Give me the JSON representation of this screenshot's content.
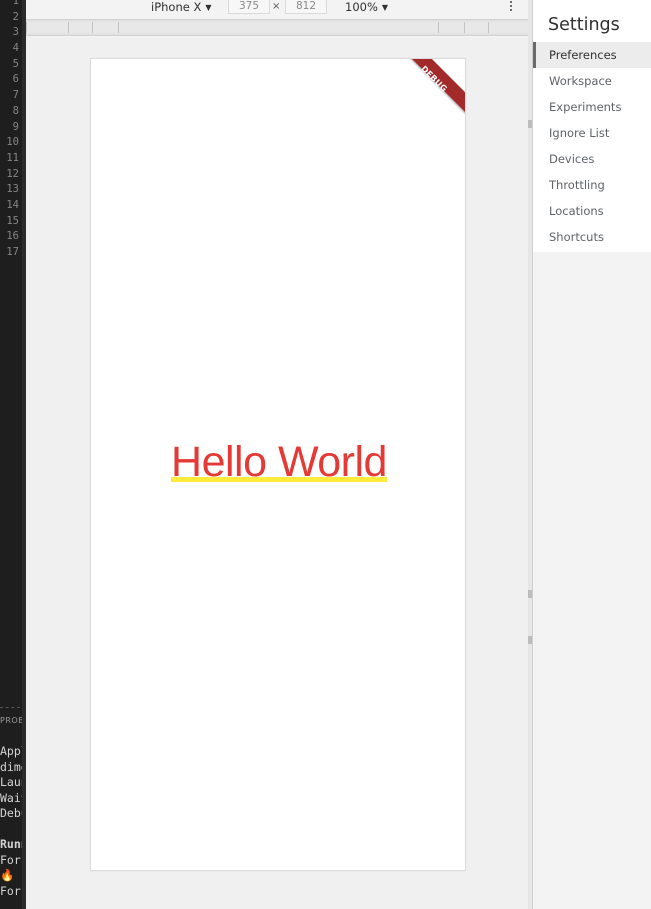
{
  "editor": {
    "line_numbers": [
      "1",
      "2",
      "3",
      "4",
      "5",
      "6",
      "7",
      "8",
      "9",
      "10",
      "11",
      "12",
      "13",
      "14",
      "15",
      "16",
      "17"
    ],
    "panel_tab": "PROB",
    "terminal_lines": [
      "Appl",
      "dime",
      "Laun",
      "Wait",
      "Debu",
      "",
      "Runn",
      "For",
      "🔥",
      "For"
    ]
  },
  "device_toolbar": {
    "device": "iPhone X",
    "width": "375",
    "times": "×",
    "height": "812",
    "zoom": "100%"
  },
  "app": {
    "debug_banner": "DEBUG",
    "hello_text": "Hello World",
    "text_color": "#e53935",
    "underline_color": "#ffeb3b",
    "banner_color": "#a32a2a"
  },
  "settings": {
    "title": "Settings",
    "items": [
      {
        "label": "Preferences",
        "selected": true
      },
      {
        "label": "Workspace"
      },
      {
        "label": "Experiments"
      },
      {
        "label": "Ignore List"
      },
      {
        "label": "Devices"
      },
      {
        "label": "Throttling"
      },
      {
        "label": "Locations"
      },
      {
        "label": "Shortcuts"
      }
    ]
  }
}
